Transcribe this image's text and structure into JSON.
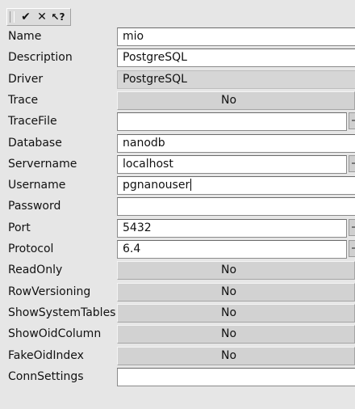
{
  "toolbar": {
    "buttons": [
      {
        "name": "ok-button",
        "glyph": "✔"
      },
      {
        "name": "cancel-button",
        "glyph": "✕"
      },
      {
        "name": "help-button",
        "glyph": "↖?"
      }
    ]
  },
  "fields": [
    {
      "label": "Name",
      "value": "mio",
      "kind": "text"
    },
    {
      "label": "Description",
      "value": "PostgreSQL",
      "kind": "text"
    },
    {
      "label": "Driver",
      "value": "PostgreSQL",
      "kind": "readonly"
    },
    {
      "label": "Trace",
      "value": "No",
      "kind": "select"
    },
    {
      "label": "TraceFile",
      "value": "",
      "kind": "text-button"
    },
    {
      "label": "Database",
      "value": "nanodb",
      "kind": "text"
    },
    {
      "label": "Servername",
      "value": "localhost",
      "kind": "text-button"
    },
    {
      "label": "Username",
      "value": "pgnanouser",
      "kind": "text",
      "caret": true
    },
    {
      "label": "Password",
      "value": "",
      "kind": "text"
    },
    {
      "label": "Port",
      "value": "5432",
      "kind": "text-button"
    },
    {
      "label": "Protocol",
      "value": "6.4",
      "kind": "text-button"
    },
    {
      "label": "ReadOnly",
      "value": "No",
      "kind": "select"
    },
    {
      "label": "RowVersioning",
      "value": "No",
      "kind": "select"
    },
    {
      "label": "ShowSystemTables",
      "value": "No",
      "kind": "select"
    },
    {
      "label": "ShowOidColumn",
      "value": "No",
      "kind": "select"
    },
    {
      "label": "FakeOidIndex",
      "value": "No",
      "kind": "select"
    },
    {
      "label": "ConnSettings",
      "value": "",
      "kind": "text"
    }
  ]
}
